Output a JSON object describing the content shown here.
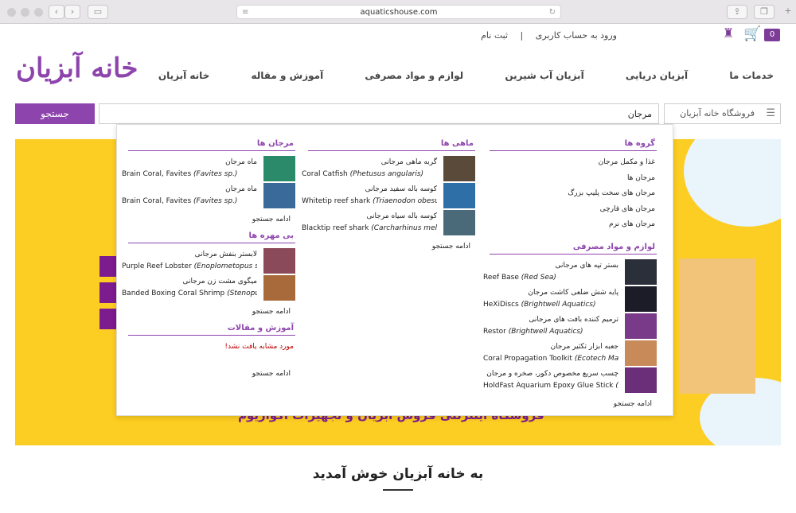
{
  "browser": {
    "url": "aquaticshouse.com",
    "new_tab": "+"
  },
  "header": {
    "login": "ورود به حساب کاربری",
    "sep": "|",
    "register": "ثبت نام",
    "cart_count": "0",
    "logo_text": "خانه آبزیان"
  },
  "nav": {
    "items": [
      "خدمات ما",
      "آبزیان دریایی",
      "آبزیان آب شیرین",
      "لوازم و مواد مصرفی",
      "آموزش و مقاله",
      "خانه آبزیان"
    ]
  },
  "search": {
    "category": "فروشگاه خانه آبزیان",
    "query": "مرجان",
    "button": "جستجو"
  },
  "dropdown": {
    "groups": {
      "title": "گروه ها",
      "items": [
        "غذا و مکمل مرجان",
        "مرجان ها",
        "مرجان های سخت پلیپ بزرگ",
        "مرجان های قارچی",
        "مرجان های نرم"
      ]
    },
    "supplies": {
      "title": "لوازم و مواد مصرفی",
      "items": [
        {
          "fa": "بستر تپه های مرجانی",
          "en": "Reef Base",
          "en2": "(Red Sea)"
        },
        {
          "fa": "پایه شش ضلعی کاشت مرجان",
          "en": "HeXiDiscs",
          "en2": "(Brightwell Aquatics)"
        },
        {
          "fa": "ترمیم کننده بافت های مرجانی",
          "en": "Restor",
          "en2": "(Brightwell Aquatics)"
        },
        {
          "fa": "جعبه ابزار تکثیر مرجان",
          "en": "Coral Propagation Toolkit",
          "en2": "(Ecotech Ma"
        },
        {
          "fa": "چسب سریع مخصوص دکور، صخره و مرجان",
          "en": "HoldFast Aquarium Epoxy Glue Stick",
          "en2": "(I"
        }
      ],
      "more": "ادامه جستجو"
    },
    "fish": {
      "title": "ماهی ها",
      "items": [
        {
          "fa": "گربه ماهی مرجانی",
          "en": "Coral Catfish",
          "en2": "(Phetusus angularis)"
        },
        {
          "fa": "کوسه باله سفید مرجانی",
          "en": "Whitetip reef shark",
          "en2": "(Triaenodon obesu"
        },
        {
          "fa": "کوسه باله سیاه مرجانی",
          "en": "Blacktip reef shark",
          "en2": "(Carcharhinus mela"
        }
      ],
      "more": "ادامه جستجو"
    },
    "corals": {
      "title": "مرجان ها",
      "items": [
        {
          "fa": "ماه مرجان",
          "en": "Brain Coral, Favites",
          "en2": "(Favites sp.)"
        },
        {
          "fa": "ماه مرجان",
          "en": "Brain Coral, Favites",
          "en2": "(Favites sp.)"
        }
      ],
      "more": "ادامه جستجو"
    },
    "invert": {
      "title": "بی مهره ها",
      "items": [
        {
          "fa": "لابستر بنفش مرجانی",
          "en": "Purple Reef Lobster",
          "en2": "(Enoplometopus s"
        },
        {
          "fa": "میگوی مشت زن مرجانی",
          "en": "Banded Boxing Coral Shrimp",
          "en2": "(Stenopu"
        }
      ],
      "more": "ادامه جستجو"
    },
    "articles": {
      "title": "آموزش و مقالات",
      "notfound": "مورد مشابه یافت نشد!",
      "more": "ادامه جستجو"
    }
  },
  "banner": {
    "slogan": "فروشگاه اینترنتی فروش آبزیان و تجهیزات آکواریوم"
  },
  "welcome": "به خانه آبزیان خوش آمدید"
}
